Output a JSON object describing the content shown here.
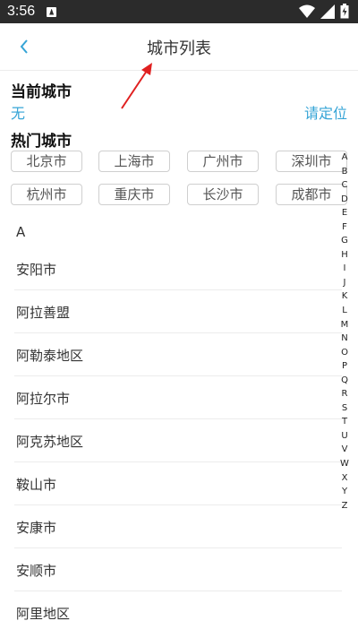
{
  "status_bar": {
    "time": "3:56"
  },
  "header": {
    "title": "城市列表"
  },
  "current_city": {
    "section_title": "当前城市",
    "value": "无",
    "locate_label": "请定位"
  },
  "hot_cities": {
    "section_title": "热门城市",
    "items": [
      "北京市",
      "上海市",
      "广州市",
      "深圳市",
      "杭州市",
      "重庆市",
      "长沙市",
      "成都市"
    ]
  },
  "city_list": {
    "letter": "A",
    "items": [
      "安阳市",
      "阿拉善盟",
      "阿勒泰地区",
      "阿拉尔市",
      "阿克苏地区",
      "鞍山市",
      "安康市",
      "安顺市",
      "阿里地区"
    ]
  },
  "index_letters": [
    "A",
    "B",
    "C",
    "D",
    "E",
    "F",
    "G",
    "H",
    "I",
    "J",
    "K",
    "L",
    "M",
    "N",
    "O",
    "P",
    "Q",
    "R",
    "S",
    "T",
    "U",
    "V",
    "W",
    "X",
    "Y",
    "Z"
  ],
  "colors": {
    "accent": "#35a4d6",
    "annotation_arrow": "#e02020",
    "status_bar": "#2b2b2b"
  }
}
